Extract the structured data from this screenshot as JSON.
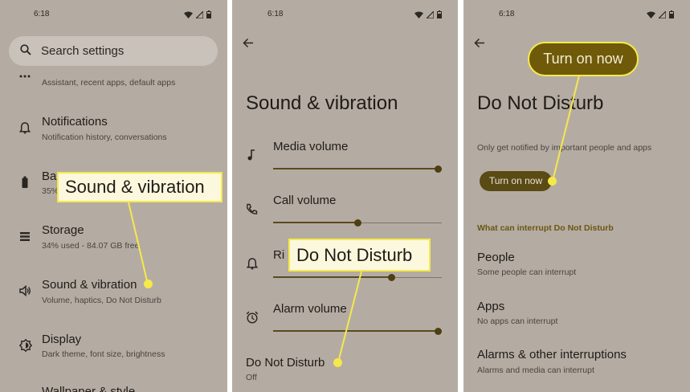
{
  "status": {
    "time": "6:18"
  },
  "panel1": {
    "search_placeholder": "Search settings",
    "items": [
      {
        "title": "",
        "sub": "Assistant, recent apps, default apps"
      },
      {
        "title": "Notifications",
        "sub": "Notification history, conversations"
      },
      {
        "title": "Ba",
        "sub": "35%"
      },
      {
        "title": "Storage",
        "sub": "34% used - 84.07 GB free"
      },
      {
        "title": "Sound & vibration",
        "sub": "Volume, haptics, Do Not Disturb"
      },
      {
        "title": "Display",
        "sub": "Dark theme, font size, brightness"
      },
      {
        "title": "Wallpaper & style",
        "sub": ""
      }
    ],
    "callout": "Sound & vibration"
  },
  "panel2": {
    "title": "Sound & vibration",
    "media_volume": {
      "label": "Media volume",
      "level": 1.0
    },
    "call_volume": {
      "label": "Call volume",
      "level": 0.5
    },
    "ring_volume": {
      "label": "Ri",
      "level": 0.71
    },
    "alarm_volume": {
      "label": "Alarm volume",
      "level": 1.0
    },
    "dnd": {
      "label": "Do Not Disturb",
      "sub": "Off"
    },
    "callout": "Do Not Disturb"
  },
  "panel3": {
    "title": "Do Not Disturb",
    "description": "Only get notified by important people and apps",
    "button": "Turn on now",
    "section_header": "What can interrupt Do Not Disturb",
    "items": [
      {
        "title": "People",
        "sub": "Some people can interrupt"
      },
      {
        "title": "Apps",
        "sub": "No apps can interrupt"
      },
      {
        "title": "Alarms & other interruptions",
        "sub": "Alarms and media can interrupt"
      }
    ],
    "callout": "Turn on now"
  },
  "colors": {
    "panel_bg": "#b4aca3",
    "accent": "#5a4a14",
    "highlight": "#f5e94a"
  }
}
